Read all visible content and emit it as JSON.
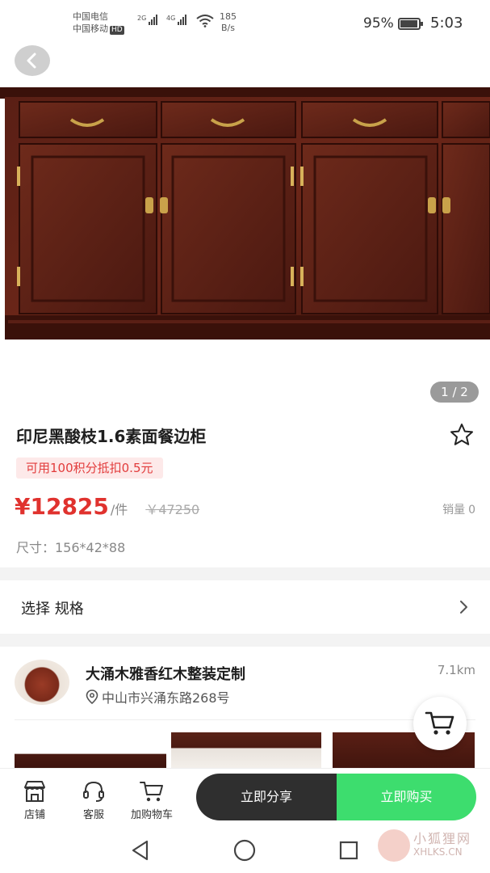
{
  "status_bar": {
    "carrier_1": "中国电信",
    "carrier_2": "中国移动",
    "hd_badge": "HD",
    "signal_1_label": "2G",
    "signal_2_label": "4G",
    "net_speed_value": "185",
    "net_speed_unit": "B/s",
    "battery_percent": "95%",
    "battery_level": 0.95,
    "time": "5:03"
  },
  "gallery": {
    "page_indicator": "1 / 2"
  },
  "product": {
    "title": "印尼黑酸枝1.6素面餐边柜",
    "promo": "可用100积分抵扣0.5元",
    "price": "¥12825",
    "unit": "/件",
    "original_price": "￥47250",
    "sales_label": "销量",
    "sales_value": "0",
    "size": "尺寸：156*42*88"
  },
  "spec": {
    "label": "选择 规格"
  },
  "store": {
    "name": "大涌木雅香红木整装定制",
    "distance": "7.1km",
    "address": "中山市兴涌东路268号"
  },
  "actions": {
    "shop": "店铺",
    "service": "客服",
    "cart": "加购物车",
    "share": "立即分享",
    "buy": "立即购买"
  },
  "watermark": {
    "text_cn": "小狐狸网",
    "text_en": "XHLKS.CN"
  },
  "colors": {
    "price": "#e0322e",
    "buy_button": "#3ddd6e",
    "share_button": "#2f2f2f",
    "promo_bg": "#fde9e9",
    "furniture": "#4a1a12"
  },
  "icons": {
    "back": "chevron-left-icon",
    "favorite": "star-outline-icon",
    "spec_arrow": "chevron-right-icon",
    "location": "location-pin-icon",
    "float_cart": "cart-icon",
    "shop": "store-icon",
    "service": "headset-icon",
    "add_cart": "cart-icon"
  }
}
